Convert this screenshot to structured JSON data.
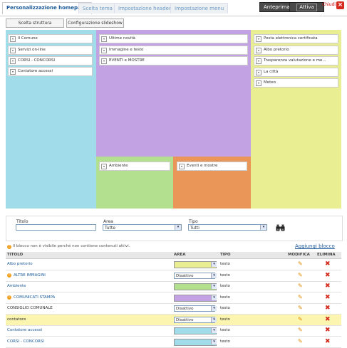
{
  "tabs": [
    {
      "label": "Personalizzazione homepage"
    },
    {
      "label": "Scelta tema"
    },
    {
      "label": "Impostazione header"
    },
    {
      "label": "Impostazione menu"
    }
  ],
  "top_buttons": {
    "preview": "Anteprima",
    "activate": "Attiva",
    "close": "Chiudi",
    "close_icon": "×"
  },
  "layout_buttons": {
    "structure": "Scelta struttura",
    "slideshow": "Configurazione slideshow"
  },
  "regions": {
    "left": [
      "Il Comune",
      "Servizi on-line",
      "CORSI - CONCORSI",
      "Contatore accessi"
    ],
    "center": [
      "Ultime novità",
      "Immagine e testo",
      "EVENTI e MOSTRE"
    ],
    "right": [
      "Posta elettronica certificata",
      "Albo pretorio",
      "Trasparenza valutazione e me...",
      "La città",
      "Meteo"
    ],
    "bottom_green": [
      "Ambiente"
    ],
    "bottom_orange": [
      "Eventi e mostre"
    ],
    "dropdown_glyph": "▾"
  },
  "colors": {
    "left": "#a0dcea",
    "center": "#c3a2e3",
    "right": "#e9ee92",
    "bottom_green": "#b2e08e",
    "bottom_orange": "#ea9658"
  },
  "filters": {
    "title_label": "Titolo",
    "title_value": "",
    "area_label": "Area",
    "area_value": "Tutte",
    "type_label": "Tipo",
    "type_value": "Tutti",
    "arrow": "▾",
    "search_icon": "binoculars-icon"
  },
  "info": {
    "icon": "!",
    "text": "Il blocco non è visibile perché non contiene contenuti attivi."
  },
  "add_block": "Aggiungi blocco",
  "table": {
    "headers": {
      "title": "TITOLO",
      "area": "AREA",
      "type": "TIPO",
      "edit": "MODIFICA",
      "delete": "ELIMINA"
    },
    "edit_icon": "✎",
    "delete_icon": "✖",
    "rows": [
      {
        "title": "Albo pretorio",
        "area_color": "#e9ee92",
        "area_text": "",
        "type": "testo",
        "warning": false,
        "highlight": false
      },
      {
        "title": "ALTRE IMMAGINI",
        "area_color": "",
        "area_text": "Disattivo",
        "type": "testo",
        "warning": true,
        "highlight": false
      },
      {
        "title": "Ambiente",
        "area_color": "#b2e08e",
        "area_text": "",
        "type": "testo",
        "warning": false,
        "highlight": false
      },
      {
        "title": "COMUNICATI STAMPA",
        "area_color": "#c3a2e3",
        "area_text": "",
        "type": "testo",
        "warning": true,
        "highlight": false
      },
      {
        "title": "CONSIGLIO COMUNALE",
        "area_color": "",
        "area_text": "Disattivo",
        "type": "testo",
        "warning": false,
        "highlight": false
      },
      {
        "title": "contatore",
        "area_color": "",
        "area_text": "Disattivo",
        "type": "testo",
        "warning": false,
        "highlight": true
      },
      {
        "title": "Contatore accessi",
        "area_color": "#a0dcea",
        "area_text": "",
        "type": "testo",
        "warning": false,
        "highlight": false
      },
      {
        "title": "CORSI - CONCORSI",
        "area_color": "#a0dcea",
        "area_text": "",
        "type": "testo",
        "warning": false,
        "highlight": false
      }
    ]
  }
}
